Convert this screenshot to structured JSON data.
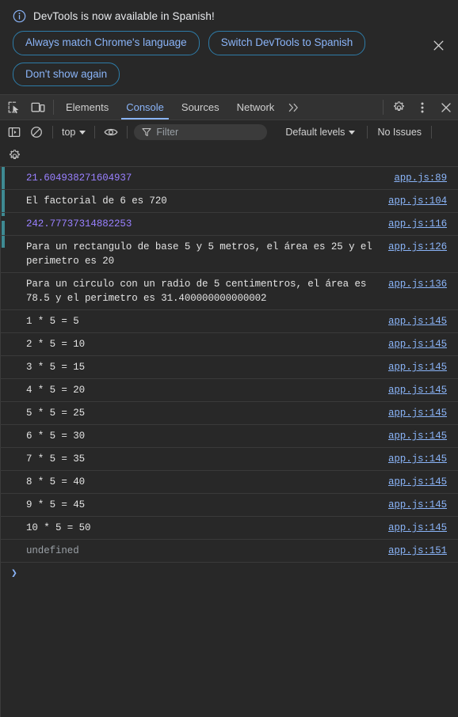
{
  "infobar": {
    "icon": "info-circle-icon",
    "message": "DevTools is now available in Spanish!",
    "buttons": [
      {
        "label": "Always match Chrome's language"
      },
      {
        "label": "Switch DevTools to Spanish"
      },
      {
        "label": "Don't show again"
      }
    ],
    "close_icon": "close-icon"
  },
  "tabbar": {
    "inspect_icon": "inspect-element-icon",
    "device_icon": "device-toolbar-icon",
    "tabs": [
      {
        "label": "Elements",
        "active": false
      },
      {
        "label": "Console",
        "active": true
      },
      {
        "label": "Sources",
        "active": false
      },
      {
        "label": "Network",
        "active": false
      }
    ],
    "more_tabs_icon": "chevron-double-right-icon",
    "more_tabs_label": "»",
    "settings_icon": "gear-icon",
    "menu_icon": "three-dots-vertical-icon",
    "close_icon": "close-icon"
  },
  "filterbar": {
    "sidebar_icon": "console-sidebar-icon",
    "clear_icon": "clear-console-icon",
    "context_label": "top",
    "eye_icon": "live-expression-icon",
    "filter_icon": "filter-funnel-icon",
    "filter_value": "",
    "filter_placeholder": "Filter",
    "levels_label": "Default levels",
    "issues_label": "No Issues",
    "settings_icon": "gear-icon"
  },
  "console": {
    "messages": [
      {
        "text": "21.604938271604937",
        "source": "app.js:89",
        "kind": "number"
      },
      {
        "text": "El factorial de 6 es 720",
        "source": "app.js:104",
        "kind": "log"
      },
      {
        "text": "242.77737314882253",
        "source": "app.js:116",
        "kind": "number"
      },
      {
        "text": "Para un rectangulo de base 5 y 5 metros, el área es 25 y el perimetro es 20",
        "source": "app.js:126",
        "kind": "log"
      },
      {
        "text": "Para un circulo con un radio de 5 centimentros, el área es 78.5 y el perimetro es 31.400000000000002",
        "source": "app.js:136",
        "kind": "log"
      },
      {
        "text": "1 * 5 = 5",
        "source": "app.js:145",
        "kind": "log"
      },
      {
        "text": "2 * 5 = 10",
        "source": "app.js:145",
        "kind": "log"
      },
      {
        "text": "3 * 5 = 15",
        "source": "app.js:145",
        "kind": "log"
      },
      {
        "text": "4 * 5 = 20",
        "source": "app.js:145",
        "kind": "log"
      },
      {
        "text": "5 * 5 = 25",
        "source": "app.js:145",
        "kind": "log"
      },
      {
        "text": "6 * 5 = 30",
        "source": "app.js:145",
        "kind": "log"
      },
      {
        "text": "7 * 5 = 35",
        "source": "app.js:145",
        "kind": "log"
      },
      {
        "text": "8 * 5 = 40",
        "source": "app.js:145",
        "kind": "log"
      },
      {
        "text": "9 * 5 = 45",
        "source": "app.js:145",
        "kind": "log"
      },
      {
        "text": "10 * 5 = 50",
        "source": "app.js:145",
        "kind": "log"
      },
      {
        "text": "undefined",
        "source": "app.js:151",
        "kind": "undefined"
      }
    ],
    "prompt_caret": "❯",
    "prompt_value": ""
  },
  "colors": {
    "background": "#282828",
    "toolbar": "#323232",
    "accent_blue": "#8ab4f8",
    "number_purple": "#9980ff",
    "text": "#e3e3e3",
    "muted": "#9aa0a6",
    "divider": "#3a3a3a",
    "pill_border": "#2e7ca8",
    "gutter_accent": "#3e8a93"
  }
}
